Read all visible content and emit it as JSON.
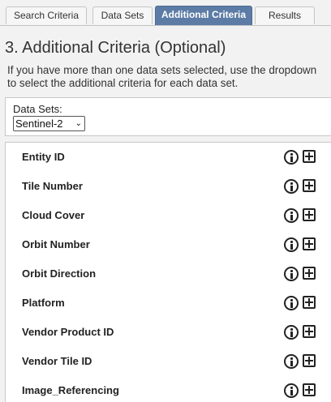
{
  "tabs": [
    {
      "label": "Search Criteria",
      "active": false
    },
    {
      "label": "Data Sets",
      "active": false
    },
    {
      "label": "Additional Criteria",
      "active": true
    },
    {
      "label": "Results",
      "active": false
    }
  ],
  "section": {
    "title": "3. Additional Criteria (Optional)",
    "description": "If you have more than one data sets selected, use the dropdown to select the additional criteria for each data set."
  },
  "datasets": {
    "label": "Data Sets:",
    "selected": "Sentinel-2"
  },
  "criteria": [
    {
      "label": "Entity ID"
    },
    {
      "label": "Tile Number"
    },
    {
      "label": "Cloud Cover"
    },
    {
      "label": "Orbit Number"
    },
    {
      "label": "Orbit Direction"
    },
    {
      "label": "Platform"
    },
    {
      "label": "Vendor Product ID"
    },
    {
      "label": "Vendor Tile ID"
    },
    {
      "label": "Image_Referencing"
    }
  ],
  "icons": {
    "info": "info-circle-icon",
    "add": "plus-square-icon"
  },
  "colors": {
    "active_tab": "#5c7ca6",
    "background": "#f2f2f2"
  }
}
